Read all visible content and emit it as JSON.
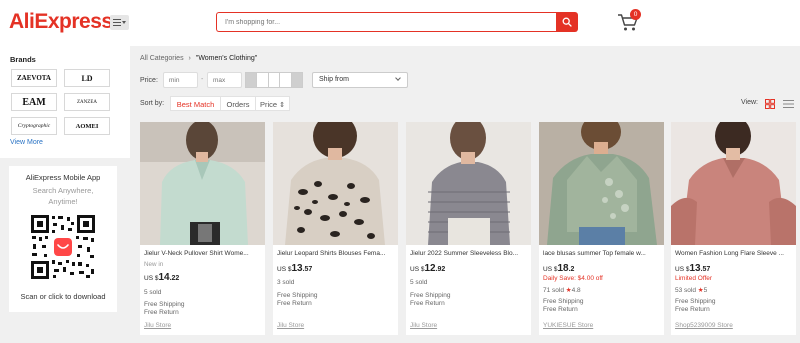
{
  "header": {
    "logo": "AliExpress",
    "search_placeholder": "I'm shopping for...",
    "cart_count": "0",
    "accent_color": "#e43225"
  },
  "sidebar": {
    "brands_title": "Brands",
    "brands": [
      "ZAEVOTA",
      "LD",
      "EAM",
      "ZANZEA",
      "Cryptographic",
      "AOMEI"
    ],
    "view_more": "View More",
    "app": {
      "title": "AliExpress Mobile App",
      "subtitle_1": "Search Anywhere,",
      "subtitle_2": "Anytime!",
      "cta": "Scan or click to download"
    }
  },
  "breadcrumb": {
    "root": "All Categories",
    "separator": "›",
    "current": "\"Women's Clothing\""
  },
  "filters": {
    "price_label": "Price:",
    "min_placeholder": "min",
    "dash": "-",
    "max_placeholder": "max",
    "ship_from": "Ship from",
    "sort_label": "Sort by:",
    "sort_options": [
      "Best Match",
      "Orders",
      "Price"
    ],
    "price_sort_icon": "⇕",
    "view_label": "View:"
  },
  "products": [
    {
      "title": "Jielur V-Neck Pullover Shirt Wome...",
      "tag": "New in",
      "currency": "US $",
      "price_int": "14",
      "price_dec": ".22",
      "sold": "5 sold",
      "shipping": "Free Shipping",
      "returns": "Free Return",
      "store": "Jilu Store"
    },
    {
      "title": "Jielur Leopard Shirts Blouses Fema...",
      "currency": "US $",
      "price_int": "13",
      "price_dec": ".57",
      "sold": "3 sold",
      "shipping": "Free Shipping",
      "returns": "Free Return",
      "store": "Jilu Store"
    },
    {
      "title": "Jielur 2022 Summer Sleeveless Blo...",
      "currency": "US $",
      "price_int": "12",
      "price_dec": ".92",
      "sold": "5 sold",
      "shipping": "Free Shipping",
      "returns": "Free Return",
      "store": "Jilu Store"
    },
    {
      "title": "lace blusas summer Top female w...",
      "currency": "US $",
      "price_int": "18",
      "price_dec": ".2",
      "promo": "Daily Save: $4.00 off",
      "sold": "71 sold",
      "rating": "4.8",
      "shipping": "Free Shipping",
      "returns": "Free Return",
      "store": "YUKIESUE Store"
    },
    {
      "title": "Women Fashion Long Flare Sleeve ...",
      "currency": "US $",
      "price_int": "13",
      "price_dec": ".57",
      "promo": "Limited Offer",
      "sold": "53 sold",
      "rating": "5",
      "shipping": "Free Shipping",
      "returns": "Free Return",
      "store": "Shop5239009 Store"
    }
  ]
}
